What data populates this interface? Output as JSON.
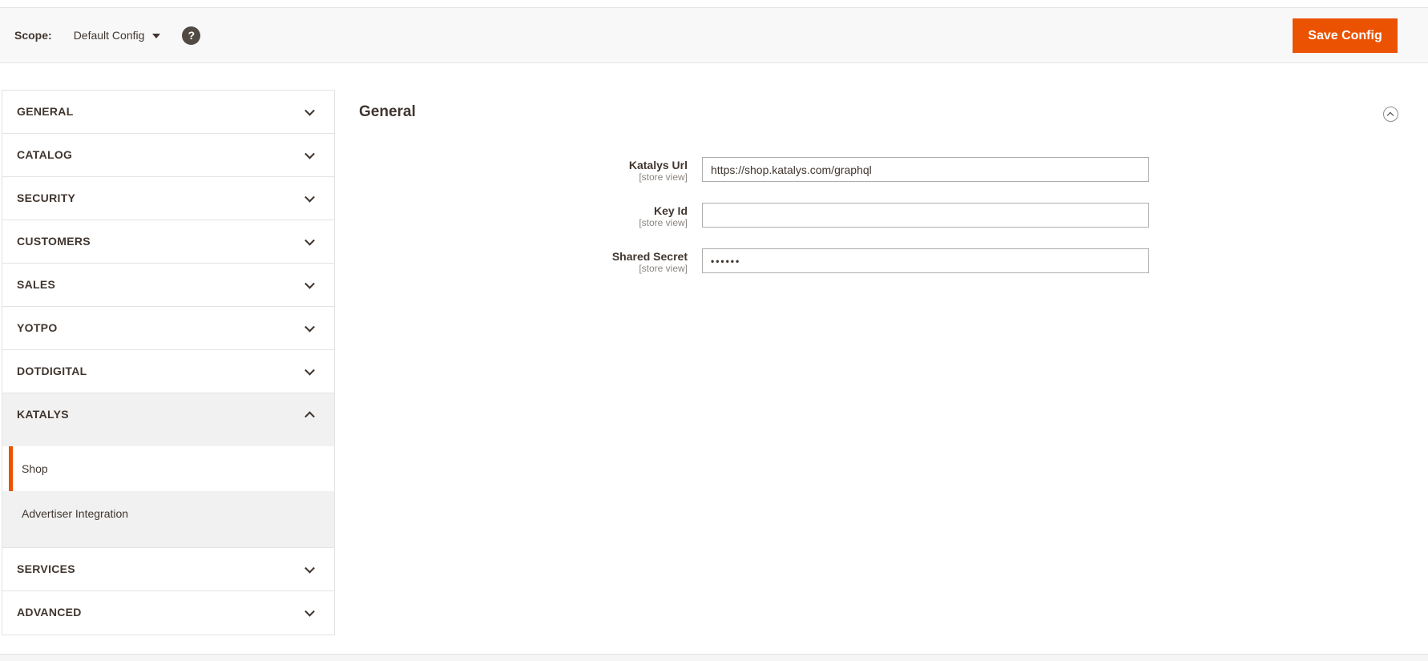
{
  "toolbar": {
    "scope_label": "Scope:",
    "scope_value": "Default Config",
    "help_symbol": "?",
    "save_label": "Save Config"
  },
  "sidebar": {
    "sections_top": [
      {
        "label": "GENERAL",
        "state": "collapsed"
      },
      {
        "label": "CATALOG",
        "state": "collapsed"
      },
      {
        "label": "SECURITY",
        "state": "collapsed"
      },
      {
        "label": "CUSTOMERS",
        "state": "collapsed"
      },
      {
        "label": "SALES",
        "state": "collapsed"
      },
      {
        "label": "YOTPO",
        "state": "collapsed"
      },
      {
        "label": "DOTDIGITAL",
        "state": "collapsed"
      },
      {
        "label": "KATALYS",
        "state": "expanded"
      }
    ],
    "subnav_items": [
      {
        "label": "Shop",
        "active": true
      },
      {
        "label": "Advertiser Integration",
        "active": false
      }
    ],
    "sections_bottom": [
      {
        "label": "SERVICES",
        "state": "collapsed"
      },
      {
        "label": "ADVANCED",
        "state": "collapsed"
      }
    ]
  },
  "main": {
    "section_title": "General",
    "fields": [
      {
        "label": "Katalys Url",
        "scope_note": "[store view]",
        "value": "https://shop.katalys.com/graphql",
        "secret": false
      },
      {
        "label": "Key Id",
        "scope_note": "[store view]",
        "value": "",
        "secret": false
      },
      {
        "label": "Shared Secret",
        "scope_note": "[store view]",
        "value": "••••••",
        "secret": true
      }
    ]
  },
  "icons": {
    "scope_caret": "caret-down",
    "help": "question-mark-circle",
    "section_collapsed": "chevron-down",
    "section_expanded": "chevron-up",
    "panel_collapse": "chevron-up-circle"
  },
  "colors": {
    "accent_orange": "#eb5202",
    "text_dark": "#41362f",
    "topbar_bg": "#f8f8f8",
    "subnav_bg": "#f1f1f1",
    "row_border": "#e3e3e3",
    "input_border": "#adadad",
    "muted_gray": "#8a8580",
    "footer_bg": "#f5f5f5"
  }
}
